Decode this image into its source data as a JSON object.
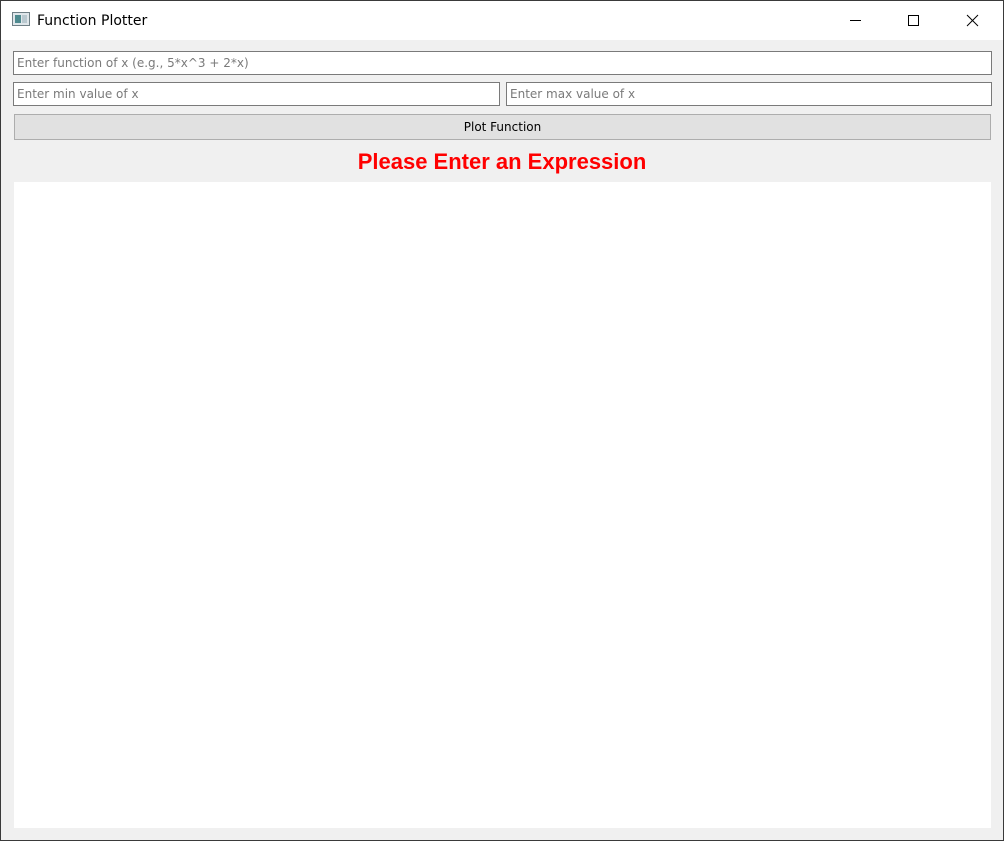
{
  "window": {
    "title": "Function Plotter",
    "icon": "app-window-icon",
    "controls": [
      "minimize-icon",
      "maximize-icon",
      "close-icon"
    ]
  },
  "form": {
    "function_input": {
      "value": "",
      "placeholder": "Enter function of x (e.g., 5*x^3 + 2*x)"
    },
    "min_input": {
      "value": "",
      "placeholder": "Enter min value of x"
    },
    "max_input": {
      "value": "",
      "placeholder": "Enter max value of x"
    },
    "plot_button_label": "Plot Function"
  },
  "status": {
    "message": "Please Enter an Expression",
    "color": "#ff0000"
  },
  "colors": {
    "window_bg": "#f0f0f0",
    "titlebar_bg": "#ffffff",
    "plot_bg": "#ffffff",
    "button_bg": "#e1e1e1"
  }
}
